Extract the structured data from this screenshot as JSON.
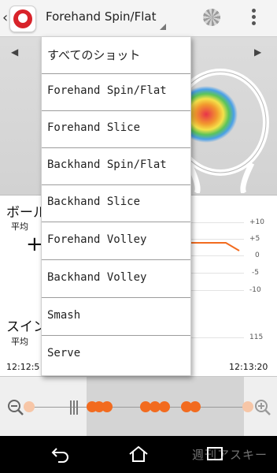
{
  "header": {
    "title": "Forehand Spin/Flat",
    "back_glyph": "‹"
  },
  "navigation": {
    "prev_glyph": "◀",
    "next_glyph": "▶"
  },
  "stats": {
    "ball_label": "ボール",
    "average_label_1": "平均",
    "plus_glyph": "+",
    "swing_label": "スイン",
    "average_label_2": "平均",
    "ticks": [
      "+10",
      "+5",
      "0",
      "-5",
      "-10",
      "115"
    ],
    "start_time": "12:12:5",
    "end_time": "12:13:20",
    "line_color": "#f26b1f"
  },
  "dropdown": {
    "items": [
      "すべてのショット",
      "Forehand Spin/Flat",
      "Forehand Slice",
      "Backhand Spin/Flat",
      "Backhand Slice",
      "Forehand Volley",
      "Backhand Volley",
      "Smash",
      "Serve"
    ]
  },
  "timeline": {
    "shot_color": "#f26b1f"
  },
  "watermark": "週刊アスキー",
  "colors": {
    "brand_red": "#d8232a",
    "accent_orange": "#f26b1f"
  }
}
